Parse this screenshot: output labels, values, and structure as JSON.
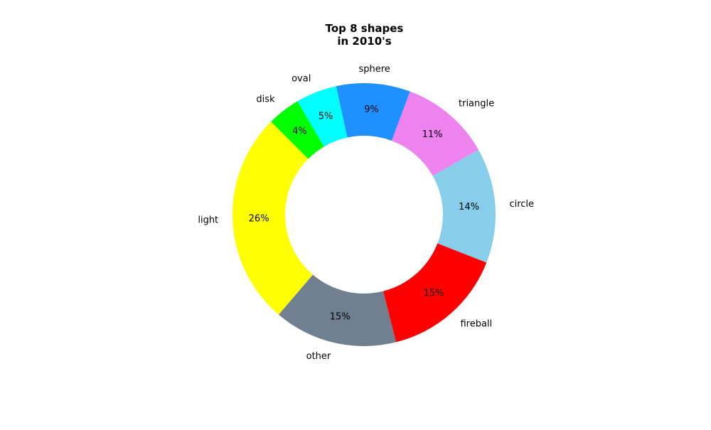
{
  "chart_data": {
    "type": "pie",
    "variant": "donut",
    "title_lines": [
      "Top 8 shapes",
      "in 2010's"
    ],
    "slices": [
      {
        "label": "light",
        "value": 26,
        "pct_label": "26%",
        "color": "#ffff00"
      },
      {
        "label": "other",
        "value": 15,
        "pct_label": "15%",
        "color": "#708090"
      },
      {
        "label": "fireball",
        "value": 15,
        "pct_label": "15%",
        "color": "#ff0000"
      },
      {
        "label": "circle",
        "value": 14,
        "pct_label": "14%",
        "color": "#87ceeb"
      },
      {
        "label": "triangle",
        "value": 11,
        "pct_label": "11%",
        "color": "#ee82ee"
      },
      {
        "label": "sphere",
        "value": 9,
        "pct_label": "9%",
        "color": "#1e90ff"
      },
      {
        "label": "oval",
        "value": 5,
        "pct_label": "5%",
        "color": "#00ffff"
      },
      {
        "label": "disk",
        "value": 4,
        "pct_label": "4%",
        "color": "#00ff00"
      }
    ]
  }
}
